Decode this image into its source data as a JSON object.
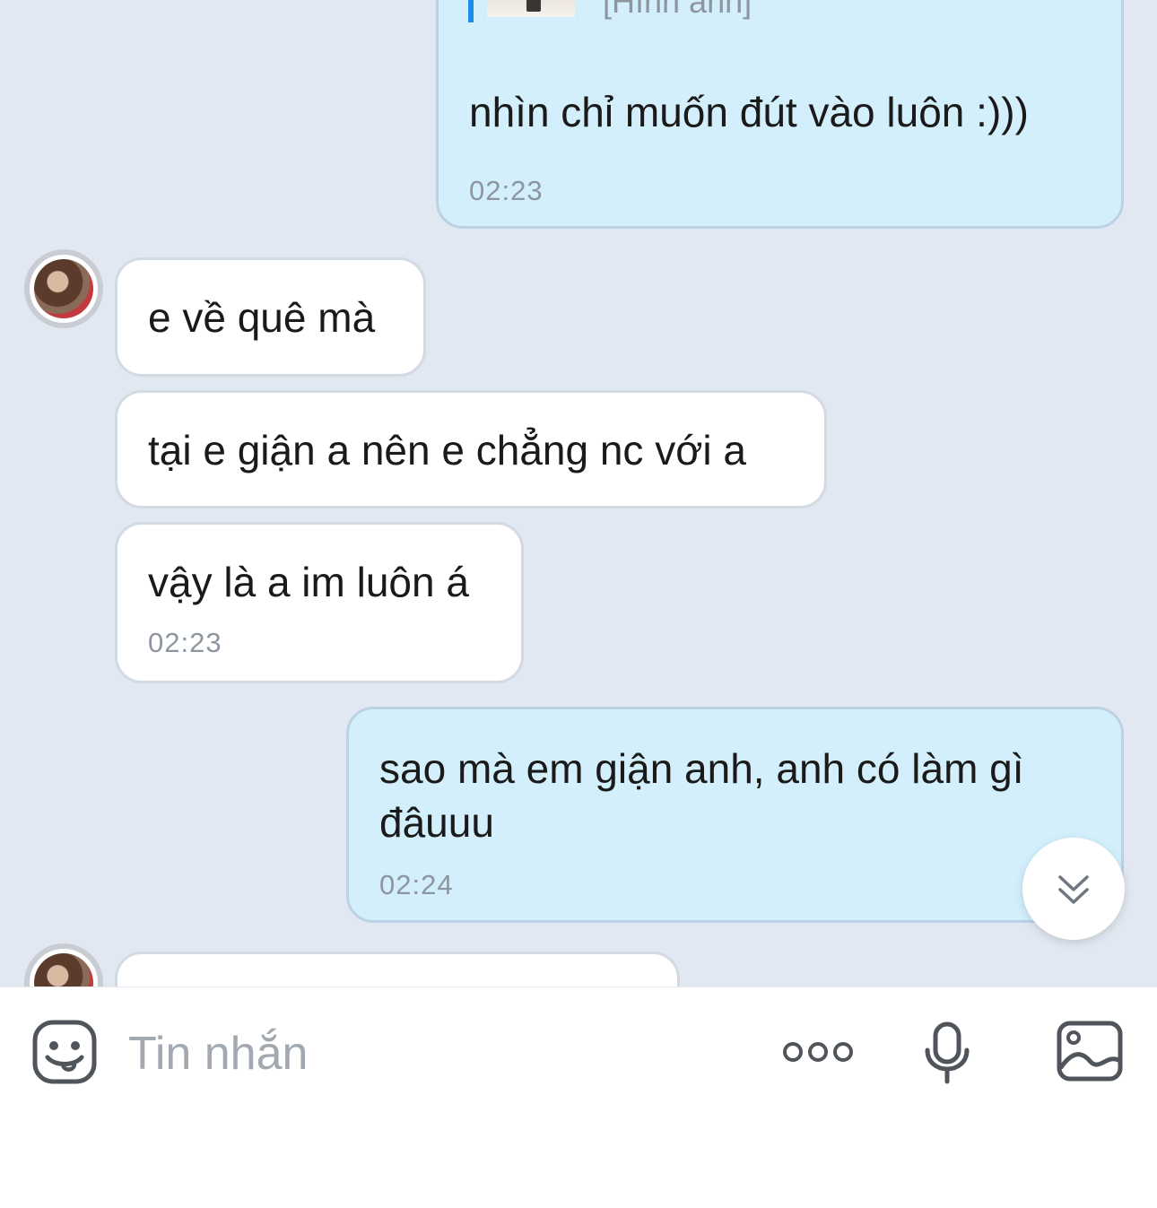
{
  "messages": [
    {
      "direction": "sent",
      "quote_label": "[Hình ảnh]",
      "text": "nhìn chỉ muốn đút vào luôn :)))",
      "time": "02:23"
    },
    {
      "direction": "received",
      "text": "e về quê mà",
      "time": ""
    },
    {
      "direction": "received",
      "text": "tại e giận a nên e chẳng nc với a",
      "time": ""
    },
    {
      "direction": "received",
      "text": "vậy là a im luôn á",
      "time": "02:23"
    },
    {
      "direction": "sent",
      "text_line1": "sao mà em giận anh, anh có làm gì",
      "text_line2": "đâuuu",
      "time": "02:24"
    }
  ],
  "composer": {
    "placeholder": "Tin nhắn",
    "icons": [
      "emoji-icon",
      "more-icon",
      "microphone-icon",
      "image-icon"
    ]
  },
  "scroll_button": {
    "icon": "double-chevron-down-icon"
  },
  "colors": {
    "background": "#e1e8f1",
    "sent_bubble": "#d3effc",
    "received_bubble": "#ffffff",
    "quote_bar": "#1c8ee8",
    "timestamp": "#8d969f"
  }
}
